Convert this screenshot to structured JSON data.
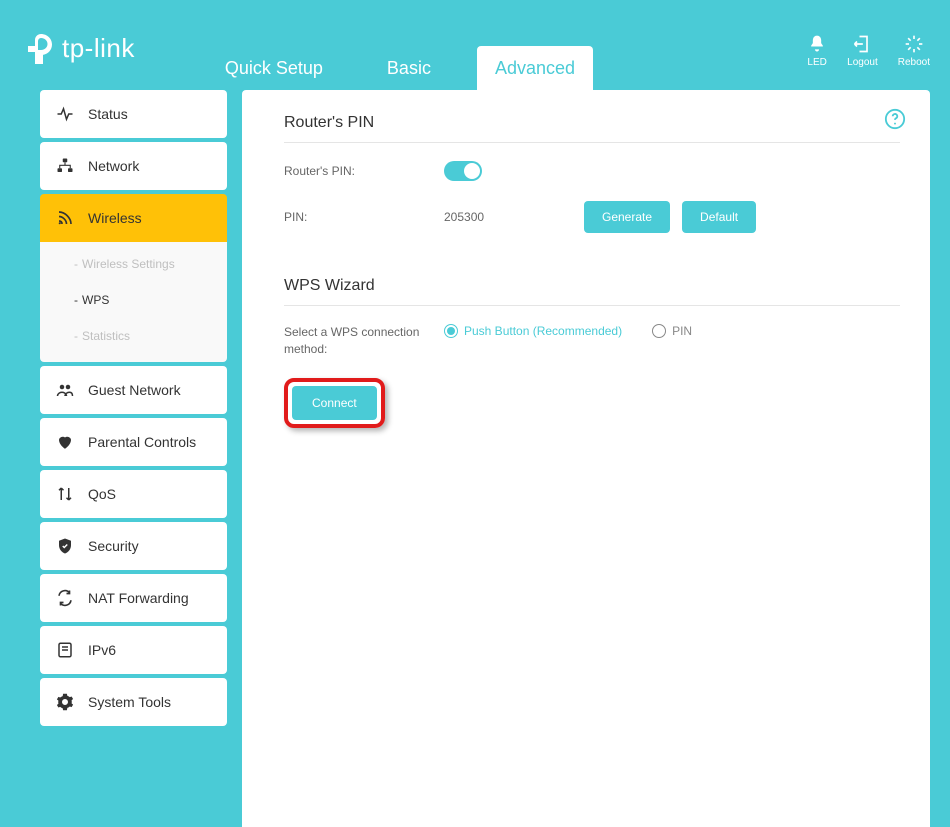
{
  "brand": "tp-link",
  "tabs": {
    "quick_setup": "Quick Setup",
    "basic": "Basic",
    "advanced": "Advanced"
  },
  "header_actions": {
    "led": "LED",
    "logout": "Logout",
    "reboot": "Reboot"
  },
  "sidebar": {
    "status": "Status",
    "network": "Network",
    "wireless": "Wireless",
    "wireless_sub": {
      "settings": "Wireless Settings",
      "wps": "WPS",
      "stats": "Statistics"
    },
    "guest_network": "Guest Network",
    "parental": "Parental Controls",
    "qos": "QoS",
    "security": "Security",
    "nat": "NAT Forwarding",
    "ipv6": "IPv6",
    "tools": "System Tools"
  },
  "main": {
    "routers_pin_title": "Router's PIN",
    "routers_pin_label": "Router's PIN:",
    "pin_label": "PIN:",
    "pin_value": "205300",
    "generate": "Generate",
    "default": "Default",
    "wps_title": "WPS Wizard",
    "wps_method_label": "Select a WPS connection method:",
    "push_button": "Push Button (Recommended)",
    "pin_option": "PIN",
    "connect": "Connect"
  }
}
